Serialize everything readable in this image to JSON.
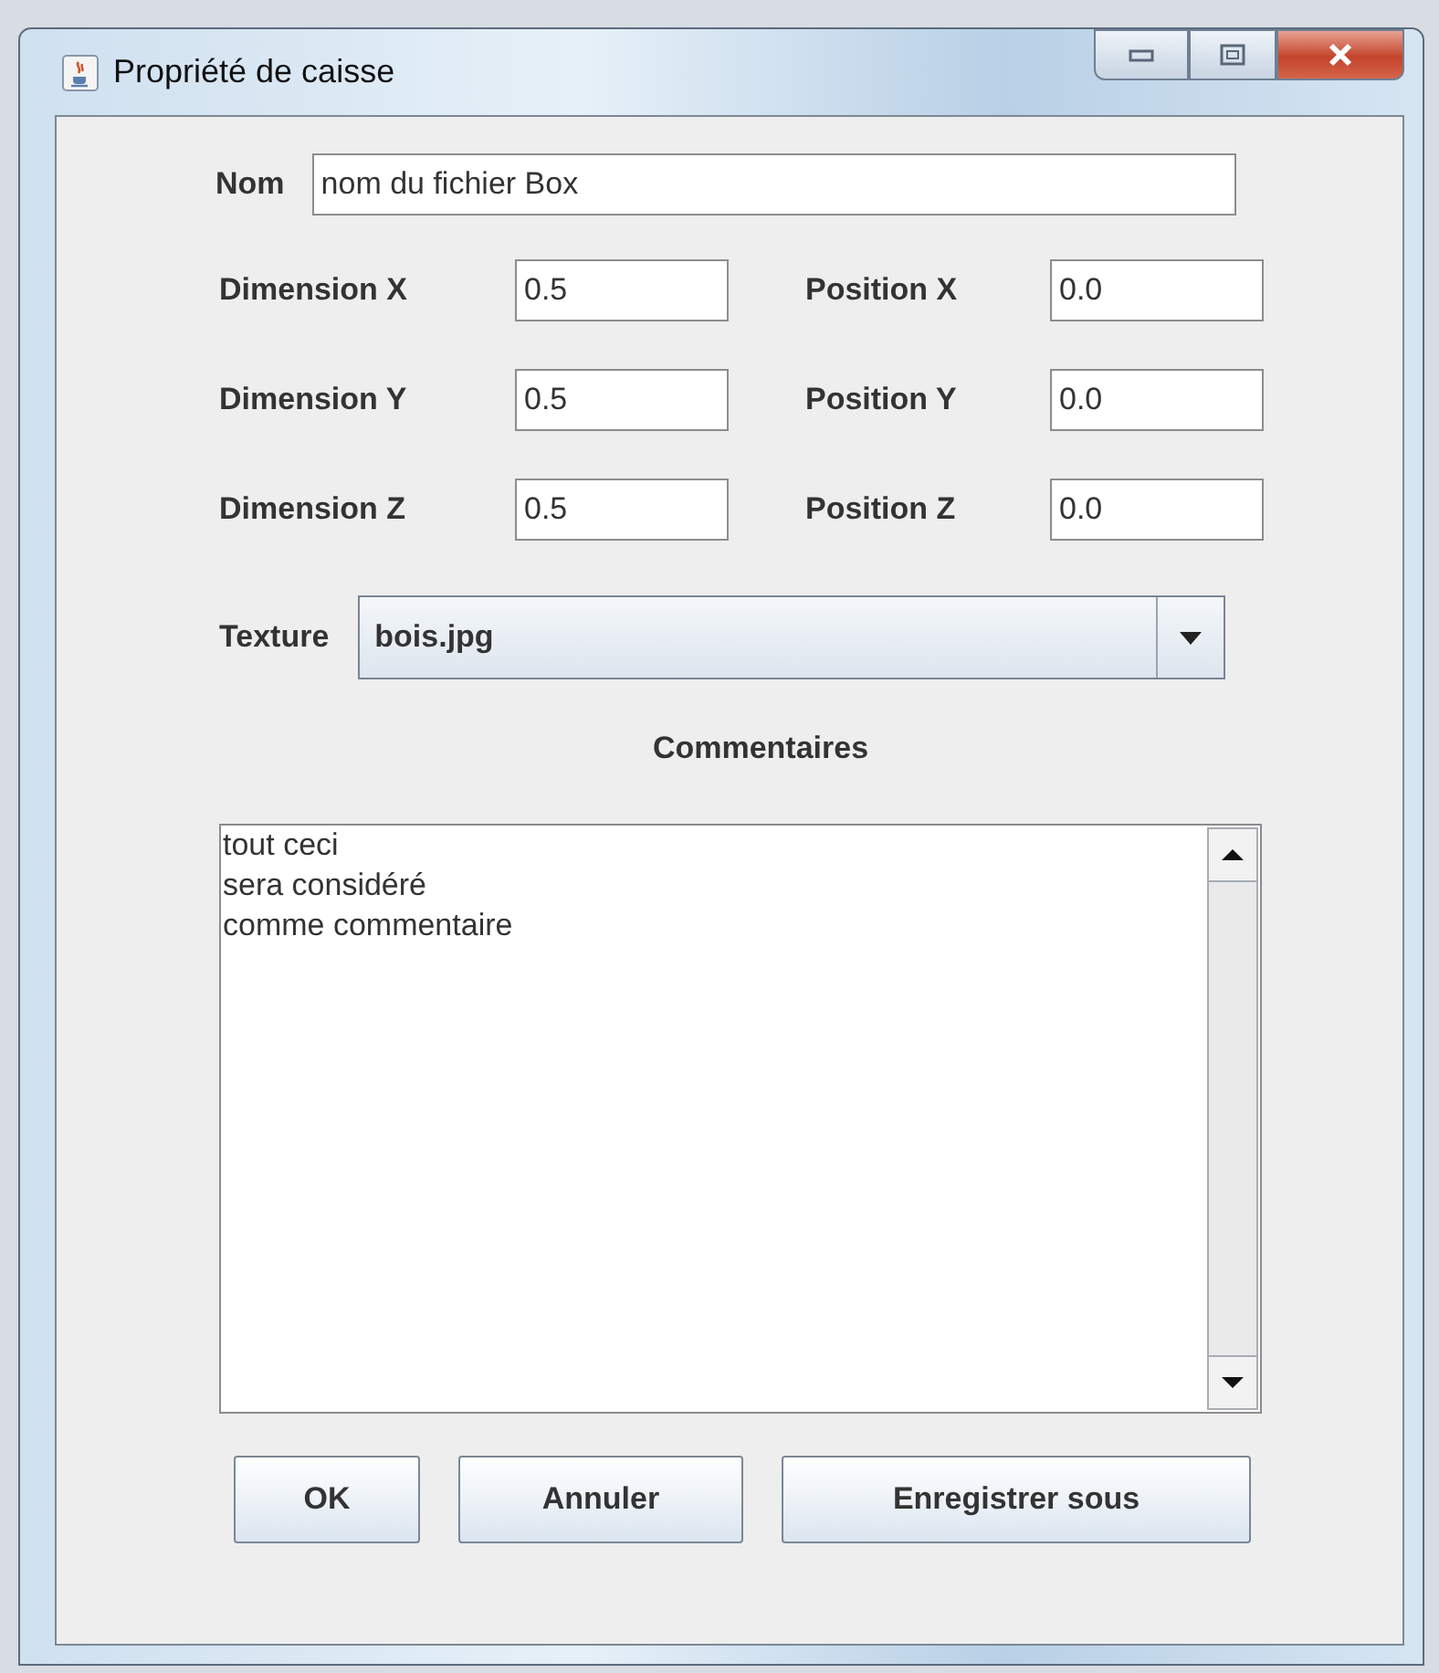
{
  "window": {
    "title": "Propriété de caisse"
  },
  "name_field": {
    "label": "Nom",
    "value": "nom du fichier Box"
  },
  "dimension_rows": [
    {
      "dimension_label": "Dimension X",
      "dimension_value": "0.5",
      "position_label": "Position X",
      "position_value": "0.0"
    },
    {
      "dimension_label": "Dimension Y",
      "dimension_value": "0.5",
      "position_label": "Position Y",
      "position_value": "0.0"
    },
    {
      "dimension_label": "Dimension Z",
      "dimension_value": "0.5",
      "position_label": "Position Z",
      "position_value": "0.0"
    }
  ],
  "texture": {
    "label": "Texture",
    "value": "bois.jpg"
  },
  "comments": {
    "heading": "Commentaires",
    "value": "tout ceci\nsera considéré\ncomme commentaire"
  },
  "buttons": [
    "OK",
    "Annuler",
    "Enregistrer sous"
  ]
}
